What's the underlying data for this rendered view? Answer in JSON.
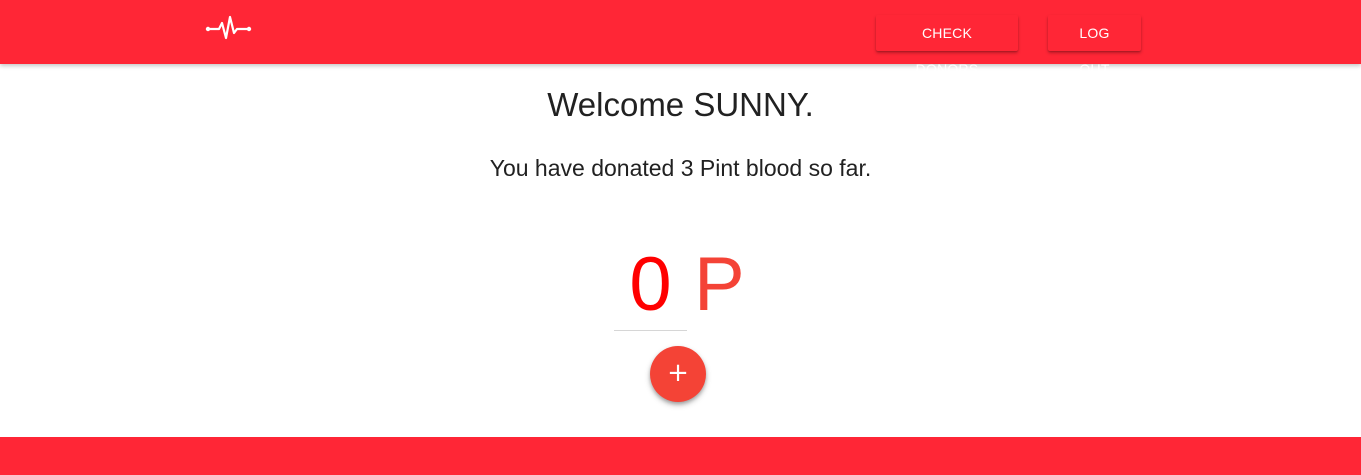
{
  "colors": {
    "brand": "#ff2636",
    "accent": "#f44336",
    "value_red": "#ff0000"
  },
  "navbar": {
    "logo_icon": "heartbeat-icon",
    "check_donors_label": "CHECK DONORS",
    "logout_label": "LOG OUT"
  },
  "main": {
    "welcome_text": "Welcome SUNNY.",
    "donated_text": "You have donated 3 Pint blood so far.",
    "pint_input_value": "0",
    "pint_unit": "P",
    "add_button_icon": "plus-icon",
    "add_button_symbol": "+"
  }
}
